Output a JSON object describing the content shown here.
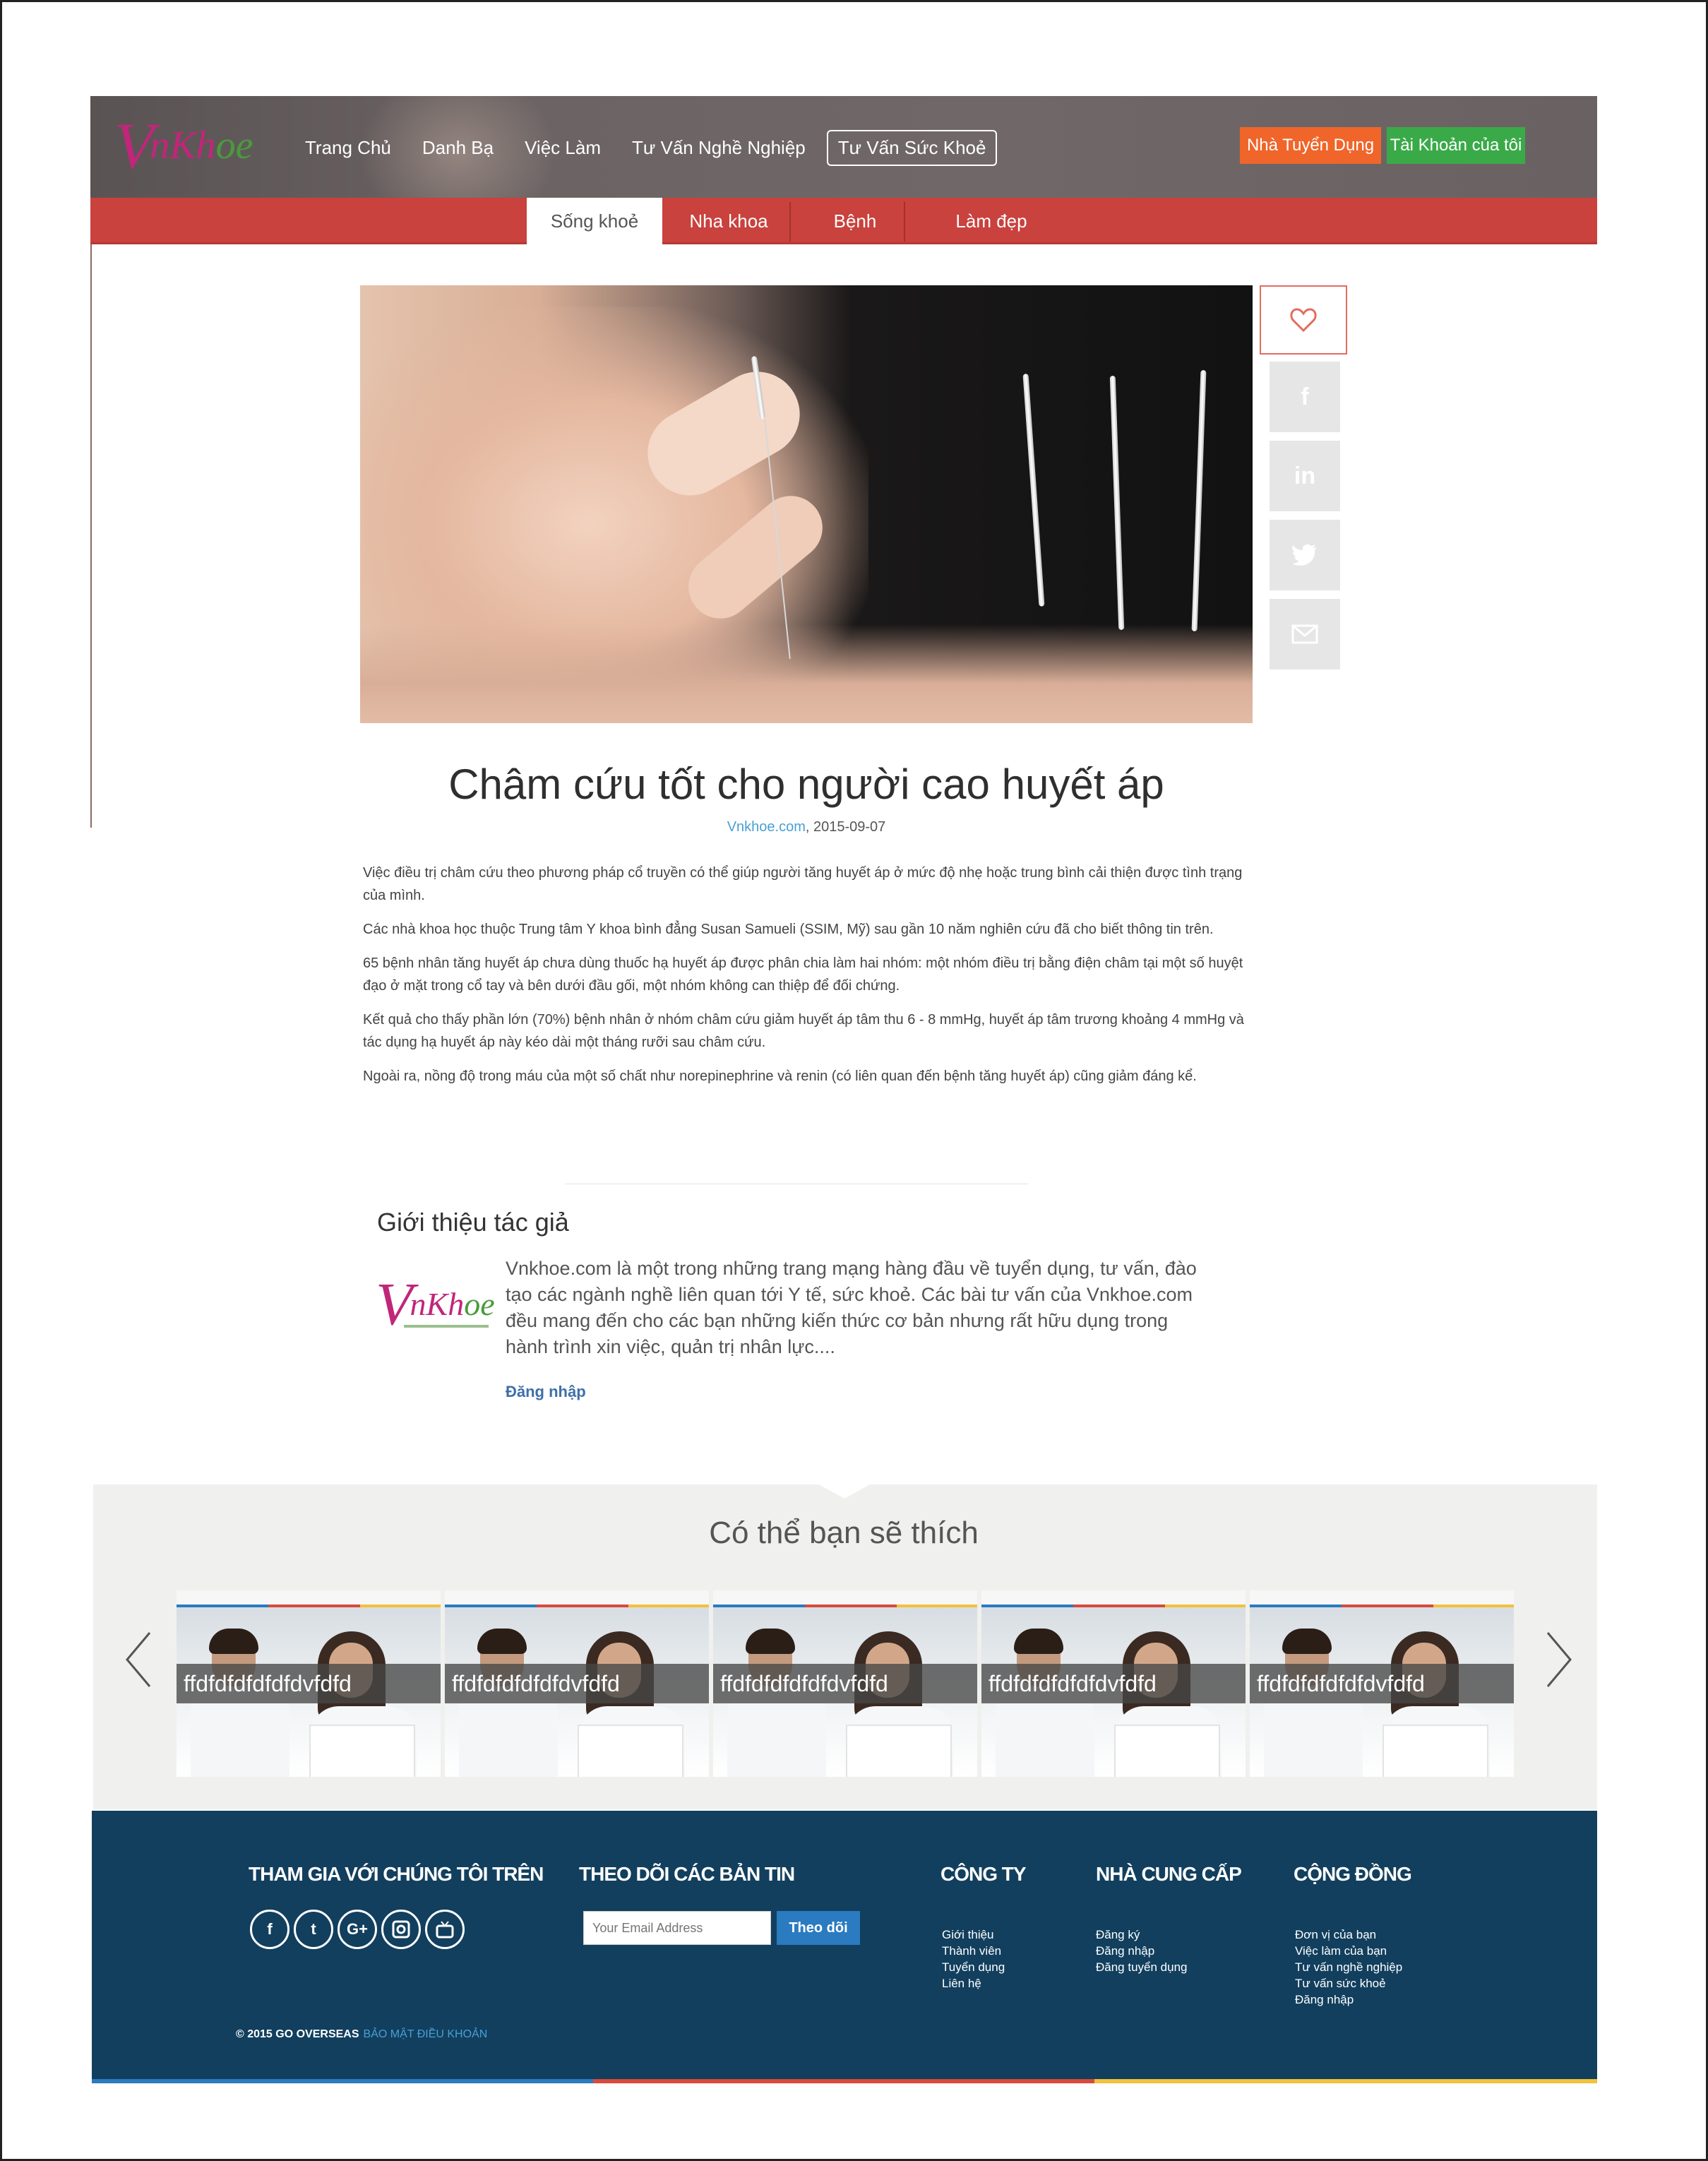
{
  "brand": {
    "logo_text": "VnKhoe",
    "colors": {
      "primary": "#c0267a",
      "accent_green": "#4b9a3c",
      "subnav": "#c9423d",
      "footer": "#123f5e"
    }
  },
  "header": {
    "nav": [
      "Trang Chủ",
      "Danh Bạ",
      "Việc Làm",
      "Tư Vấn Nghề Nghiệp",
      "Tư Vấn Sức Khoẻ"
    ],
    "active_nav": "Tư Vấn Sức Khoẻ",
    "employer_button": "Nhà Tuyển Dụng",
    "account_button": "Tài Khoản của tôi"
  },
  "subnav": {
    "items": [
      "Sống khoẻ",
      "Nha khoa",
      "Bệnh",
      "Làm đẹp"
    ],
    "active": "Sống khoẻ"
  },
  "share": {
    "icons": [
      "heart-icon",
      "facebook-icon",
      "linkedin-icon",
      "twitter-icon",
      "email-icon"
    ]
  },
  "article": {
    "title": "Châm cứu tốt cho người cao huyết áp",
    "source": "Vnkhoe.com",
    "date": ", 2015-09-07",
    "paragraphs": [
      "Việc điều trị châm cứu theo phương pháp cổ truyền có thể giúp người tăng huyết áp ở mức độ nhẹ hoặc trung bình cải thiện được tình trạng của mình.",
      "Các nhà khoa học thuộc Trung tâm Y khoa bình đẳng Susan Samueli (SSIM, Mỹ) sau gần 10 năm nghiên cứu đã cho biết thông tin trên.",
      "65 bệnh nhân tăng huyết áp chưa dùng thuốc hạ huyết áp được phân chia làm hai nhóm: một nhóm điều trị bằng điện châm tại một số huyệt đạo ở mặt trong cổ tay và bên dưới đầu gối, một nhóm không can thiệp để đối chứng.",
      "Kết quả cho thấy phần lớn (70%) bệnh nhân ở nhóm châm cứu giảm huyết áp tâm thu 6 - 8 mmHg, huyết áp tâm trương khoảng 4 mmHg và tác dụng hạ huyết áp này kéo dài một tháng rưỡi sau châm cứu.",
      "Ngoài ra, nồng độ trong máu của một số chất như norepinephrine và renin (có liên quan đến bệnh tăng huyết áp) cũng giảm đáng kể."
    ]
  },
  "author": {
    "heading": "Giới thiệu tác giả",
    "description": "Vnkhoe.com là một trong những trang mạng hàng đầu về tuyển dụng, tư vấn, đào tạo các ngành nghề liên quan tới Y tế, sức khoẻ. Các bài tư vấn của Vnkhoe.com đều mang đến cho các bạn những kiến thức cơ bản nhưng rất hữu dụng trong hành trình xin việc, quản trị nhân lực....",
    "login_link": "Đăng nhập"
  },
  "recommendations": {
    "title": "Có thể bạn sẽ thích",
    "cards": [
      "ffdfdfdfdfdfdvfdfd",
      "ffdfdfdfdfdfdvfdfd",
      "ffdfdfdfdfdfdvfdfd",
      "ffdfdfdfdfdfdvfdfd",
      "ffdfdfdfdfdfdvfdfd"
    ]
  },
  "footer": {
    "join_heading": "THAM GIA VỚI CHÚNG TÔI TRÊN",
    "newsletter_heading": "THEO DÕI CÁC BẢN TIN",
    "email_placeholder": "Your Email Address",
    "subscribe_button": "Theo dõi",
    "company_heading": "CÔNG TY",
    "company_links": [
      "Giới thiệu",
      "Thành viên",
      "Tuyển dụng",
      "Liên hệ"
    ],
    "provider_heading": "NHÀ CUNG CẤP",
    "provider_links": [
      "Đăng ký",
      "Đăng nhập",
      "Đăng tuyển dụng"
    ],
    "community_heading": "CỘNG ĐỒNG",
    "community_links": [
      "Đơn vị của bạn",
      "Việc làm của bạn",
      "Tư vấn nghề nghiệp",
      "Tư vấn sức khoẻ",
      "Đăng nhập"
    ],
    "social_icons": [
      "facebook-icon",
      "twitter-icon",
      "google-plus-icon",
      "instagram-icon",
      "youtube-icon"
    ],
    "copyright": "© 2015 GO OVERSEAS",
    "legal_links": "BẢO MẬT ĐIỀU KHOẢN"
  }
}
